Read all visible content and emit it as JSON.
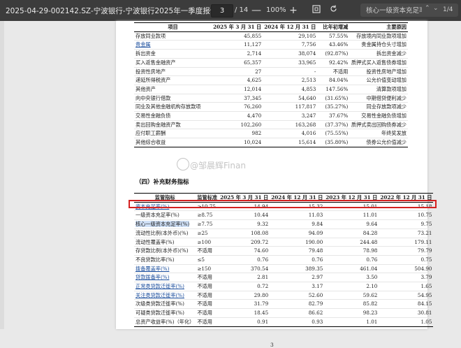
{
  "toolbar": {
    "filename": "2025-04-29-002142.SZ-宁波银行-宁波银行2025年一季度报告.pdf",
    "page_current": "3",
    "page_total": "/ 14",
    "zoom": "100%",
    "zoom_out": "—",
    "zoom_in": "+",
    "search_value": "核心一级资本充足率",
    "match_count": "1/4"
  },
  "table1": {
    "headers": [
      "项目",
      "2025 年 3 月 31 日",
      "2024 年 12 月 31 日",
      "比年初增减",
      "主要原因"
    ],
    "rows": [
      [
        "存放同业款项",
        "45,855",
        "29,105",
        "57.55%",
        "存放境内同业款项增加"
      ],
      [
        "贵金属",
        "11,127",
        "7,756",
        "43.46%",
        "贵金属持仓头寸增加"
      ],
      [
        "拆出资金",
        "2,714",
        "38,074",
        "(92.87%)",
        "拆出资金减少"
      ],
      [
        "买入返售金融资产",
        "65,357",
        "33,965",
        "92.42%",
        "质押式买入返售债券增加"
      ],
      [
        "投资性房地产",
        "27",
        "-",
        "不适用",
        "投资性房地产增加"
      ],
      [
        "递延所得税资产",
        "4,625",
        "2,513",
        "84.04%",
        "公允价值变动增加"
      ],
      [
        "其他资产",
        "12,014",
        "4,853",
        "147.56%",
        "清算款项增加"
      ],
      [
        "向中央银行借款",
        "37,345",
        "54,640",
        "(31.65%)",
        "中期借贷便利减少"
      ],
      [
        "同业及其他金融机构存放款项",
        "76,260",
        "117,817",
        "(35.27%)",
        "同业存放款项减少"
      ],
      [
        "交易性金融负债",
        "4,470",
        "3,247",
        "37.67%",
        "交易性金融负债增加"
      ],
      [
        "卖出回购金融资产款",
        "102,260",
        "163,268",
        "(37.37%)",
        "质押式卖出回购债券减少"
      ],
      [
        "应付职工薪酬",
        "982",
        "4,016",
        "(75.55%)",
        "年终奖发放"
      ],
      [
        "其他综合收益",
        "10,024",
        "15,614",
        "(35.80%)",
        "债券公允价值减少"
      ]
    ]
  },
  "section_title": "（四）补充财务指标",
  "watermark": "@邹晨辉Finan",
  "table2": {
    "headers": [
      "监管指标",
      "监管标准",
      "2025 年 3 月 31 日",
      "2024 年 12 月 31 日",
      "2023 年 12 月 31 日",
      "2022 年 12 月 31 日"
    ],
    "rows": [
      [
        "资本充足率(%)",
        "≥10.75",
        "14.94",
        "15.32",
        "15.01",
        "15.18"
      ],
      [
        "一级资本充足率(%)",
        "≥8.75",
        "10.44",
        "11.03",
        "11.01",
        "10.75"
      ],
      [
        "核心一级资本充足率(%)",
        "≥7.75",
        "9.32",
        "9.84",
        "9.64",
        "9.75"
      ],
      [
        "流动性比例(本外币)(%)",
        "≥25",
        "108.08",
        "94.09",
        "84.28",
        "73.21"
      ],
      [
        "流动性覆盖率(%)",
        "≥100",
        "209.72",
        "190.00",
        "244.48",
        "179.11"
      ],
      [
        "存贷款比例(本外币)(%)",
        "不适用",
        "74.60",
        "79.48",
        "78.98",
        "79.79"
      ],
      [
        "不良贷款比率(%)",
        "≤5",
        "0.76",
        "0.76",
        "0.76",
        "0.75"
      ],
      [
        "拨备覆盖率(%)",
        "≥150",
        "370.54",
        "389.35",
        "461.04",
        "504.90"
      ],
      [
        "贷款拨备率(%)",
        "不适用",
        "2.81",
        "2.97",
        "3.50",
        "3.79"
      ],
      [
        "正常类贷款迁徙率(%)",
        "不适用",
        "0.72",
        "3.17",
        "2.10",
        "1.65"
      ],
      [
        "关注类贷款迁徙率(%)",
        "不适用",
        "29.80",
        "52.60",
        "59.62",
        "54.95"
      ],
      [
        "次级类贷款迁徙率(%)",
        "不适用",
        "31.79",
        "82.79",
        "85.82",
        "84.15"
      ],
      [
        "可疑类贷款迁徙率(%)",
        "不适用",
        "18.45",
        "86.62",
        "98.23",
        "30.81"
      ],
      [
        "总资产收益率(%)（年化）",
        "不适用",
        "0.91",
        "0.93",
        "1.01",
        "1.05"
      ]
    ]
  },
  "page_number": "3",
  "colors": {
    "highlight_box": "#d42121",
    "link": "#1a4d9c",
    "toolbar": "#3c3c3c"
  }
}
